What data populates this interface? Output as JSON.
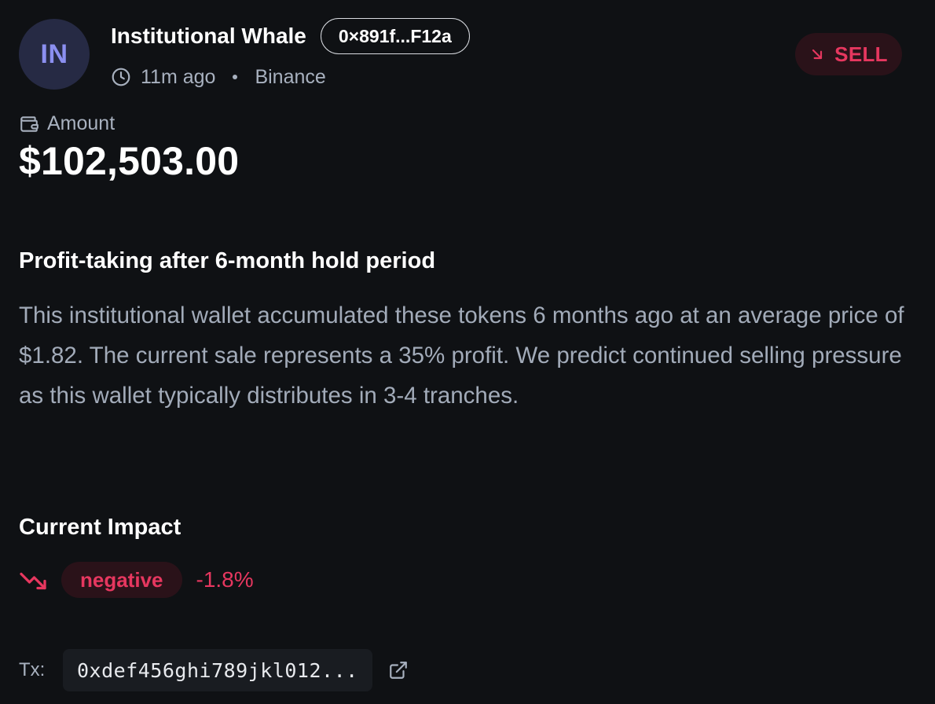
{
  "wallet": {
    "initials": "IN",
    "name": "Institutional Whale",
    "address_short": "0×891f...F12a",
    "time_ago": "11m ago",
    "exchange": "Binance"
  },
  "trade": {
    "side": "SELL",
    "amount_label": "Amount",
    "amount": "$102,503.00"
  },
  "analysis": {
    "title": "Profit-taking after 6-month hold period",
    "body": "This institutional wallet accumulated these tokens 6 months ago at an average price of $1.82. The current sale represents a 35% profit. We predict continued selling pressure as this wallet typically distributes in 3-4 tranches."
  },
  "impact": {
    "title": "Current Impact",
    "sentiment": "negative",
    "change": "-1.8%"
  },
  "tx": {
    "label": "Tx:",
    "hash_short": "0xdef456ghi789jkl012..."
  },
  "colors": {
    "background": "#0f1114",
    "negative": "#e6375f",
    "negative_bg": "#2a1219",
    "avatar_bg": "#262a44",
    "avatar_text": "#8b8ff0",
    "muted_text": "#a8b1bf"
  },
  "icons": {
    "clock": "clock-icon",
    "wallet": "wallet-icon",
    "sell_arrow": "arrow-down-right-icon",
    "trend": "trending-down-icon",
    "external": "external-link-icon"
  }
}
